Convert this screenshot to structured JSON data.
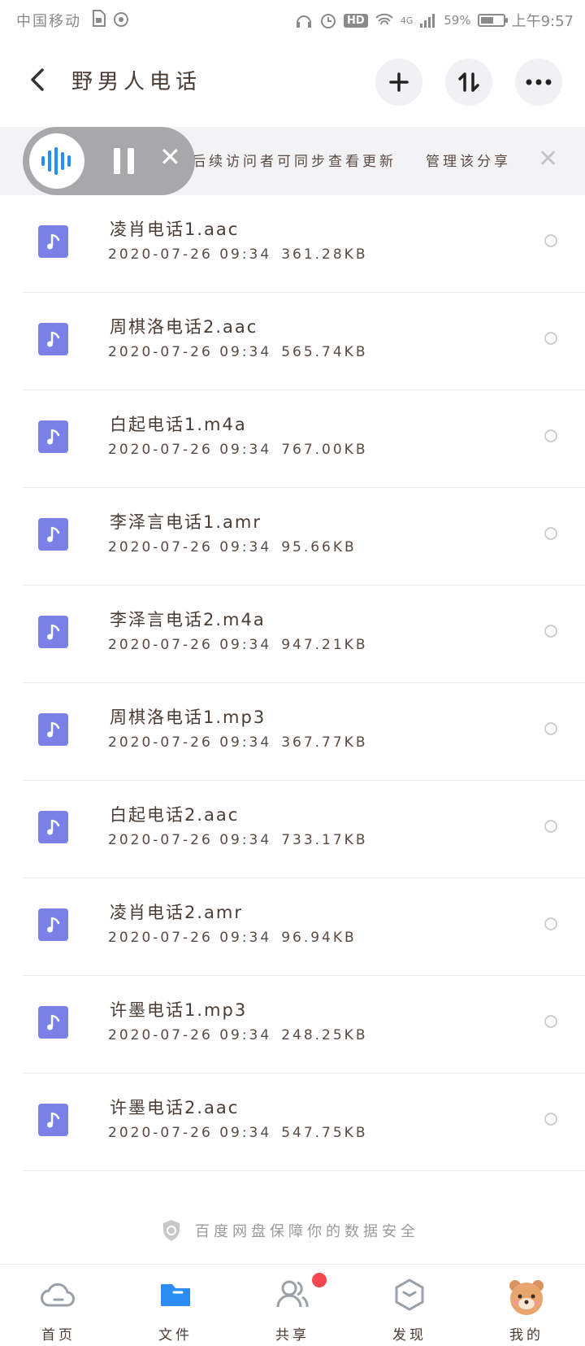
{
  "status_bar": {
    "carrier": "中国移动",
    "network": "4G",
    "battery": "59%",
    "battery_level": 0.59,
    "time": "上午9:57",
    "hd_label": "HD"
  },
  "header": {
    "title": "野男人电话",
    "icons": [
      "back-arrow-icon",
      "plus-icon",
      "sort-icon",
      "more-icon"
    ]
  },
  "notice": {
    "text": "后续访问者可同步查看更新",
    "manage_label": "管理该分享"
  },
  "files": [
    {
      "name": "凌肖电话1.aac",
      "date": "2020-07-26 09:34",
      "size": "361.28KB"
    },
    {
      "name": "周棋洛电话2.aac",
      "date": "2020-07-26 09:34",
      "size": "565.74KB"
    },
    {
      "name": "白起电话1.m4a",
      "date": "2020-07-26 09:34",
      "size": "767.00KB"
    },
    {
      "name": "李泽言电话1.amr",
      "date": "2020-07-26 09:34",
      "size": "95.66KB"
    },
    {
      "name": "李泽言电话2.m4a",
      "date": "2020-07-26 09:34",
      "size": "947.21KB"
    },
    {
      "name": "周棋洛电话1.mp3",
      "date": "2020-07-26 09:34",
      "size": "367.77KB"
    },
    {
      "name": "白起电话2.aac",
      "date": "2020-07-26 09:34",
      "size": "733.17KB"
    },
    {
      "name": "凌肖电话2.amr",
      "date": "2020-07-26 09:34",
      "size": "96.94KB"
    },
    {
      "name": "许墨电话1.mp3",
      "date": "2020-07-26 09:34",
      "size": "248.25KB"
    },
    {
      "name": "许墨电话2.aac",
      "date": "2020-07-26 09:34",
      "size": "547.75KB"
    }
  ],
  "footer_note": "百度网盘保障你的数据安全",
  "tabs": [
    {
      "label": "首页",
      "icon": "cloud-icon"
    },
    {
      "label": "文件",
      "icon": "folder-icon"
    },
    {
      "label": "共享",
      "icon": "people-icon"
    },
    {
      "label": "发现",
      "icon": "discover-icon"
    },
    {
      "label": "我的",
      "icon": "bear-avatar-icon"
    }
  ],
  "colors": {
    "accent": "#2b8cf2",
    "file_icon": "#7b80e6",
    "badge": "#f5474f"
  }
}
